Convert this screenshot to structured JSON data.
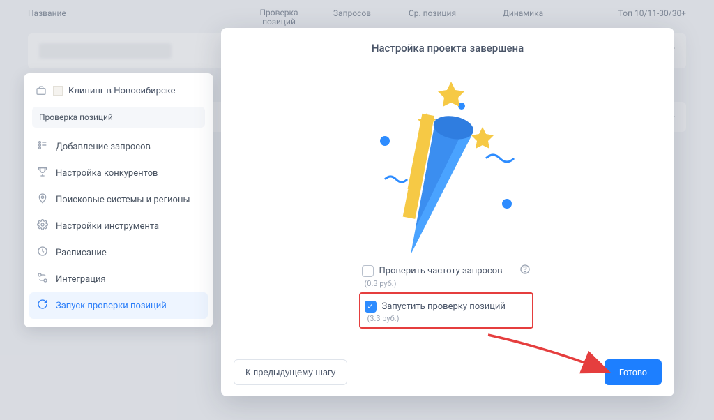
{
  "table": {
    "headers": {
      "name": "Название",
      "check": "Проверка позиций",
      "requests": "Запросов",
      "avg": "Ср. позиция",
      "dyn": "Динамика",
      "top": "Топ 10/11-30/30+"
    },
    "dash": "-"
  },
  "sidebar": {
    "project_name": "Клининг в Новосибирске",
    "section": "Проверка позиций",
    "items": [
      {
        "label": "Добавление запросов"
      },
      {
        "label": "Настройка конкурентов"
      },
      {
        "label": "Поисковые системы и регионы"
      },
      {
        "label": "Настройки инструмента"
      },
      {
        "label": "Расписание"
      },
      {
        "label": "Интеграция"
      },
      {
        "label": "Запуск проверки позиций"
      }
    ]
  },
  "modal": {
    "title": "Настройка проекта завершена",
    "opt_freq_label": "Проверить частоту запросов",
    "opt_freq_sub": "(0.3 руб.)",
    "opt_run_label": "Запустить проверку позиций",
    "opt_run_sub": "(3.3 руб.)",
    "btn_prev": "К предыдущему шагу",
    "btn_done": "Готово"
  }
}
